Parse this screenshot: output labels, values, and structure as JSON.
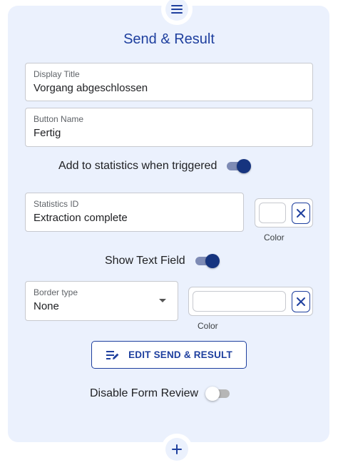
{
  "header": {
    "menu_icon": "menu-icon",
    "title": "Send & Result"
  },
  "display_title": {
    "label": "Display Title",
    "value": "Vorgang abgeschlossen"
  },
  "button_name": {
    "label": "Button Name",
    "value": "Fertig"
  },
  "statistics_toggle": {
    "label": "Add to statistics when triggered",
    "checked": true
  },
  "statistics_id": {
    "label": "Statistics ID",
    "value": "Extraction complete",
    "color_caption": "Color"
  },
  "text_field_toggle": {
    "label": "Show Text Field",
    "checked": true
  },
  "border_type": {
    "label": "Border type",
    "value": "None",
    "color_caption": "Color"
  },
  "edit_button": {
    "label": "EDIT SEND & RESULT",
    "icon": "edit-list-icon"
  },
  "form_review_toggle": {
    "label": "Disable Form Review",
    "checked": false
  },
  "footer": {
    "add_icon": "plus-icon"
  },
  "colors": {
    "accent": "#1e3f9e",
    "panel_bg": "#ebf1fd",
    "toggle_on": "#16347f"
  }
}
